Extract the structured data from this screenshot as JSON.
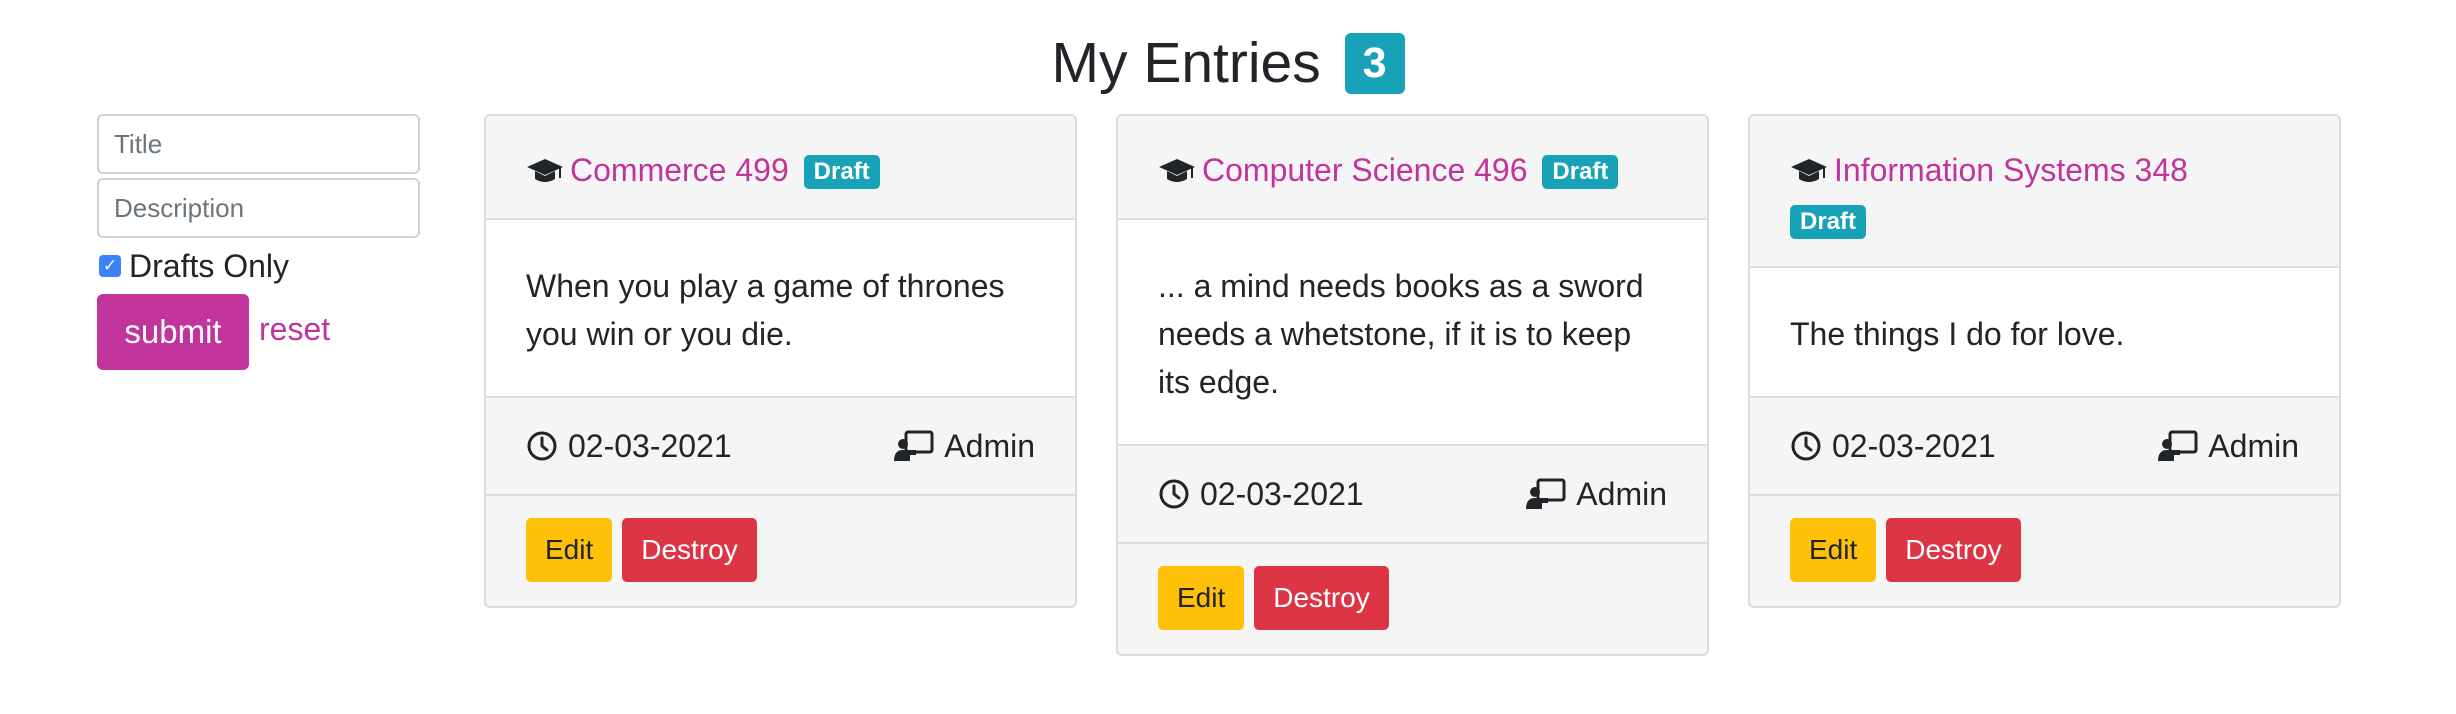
{
  "header": {
    "title": "My Entries",
    "count": "3"
  },
  "filter": {
    "title_placeholder": "Title",
    "description_placeholder": "Description",
    "drafts_label": "Drafts Only",
    "drafts_checked": true,
    "submit_label": "submit",
    "reset_label": "reset"
  },
  "entries": [
    {
      "title": "Commerce 499",
      "badge": "Draft",
      "body": "When you play a game of thrones you win or you die.",
      "date": "02-03-2021",
      "author": "Admin",
      "edit_label": "Edit",
      "destroy_label": "Destroy"
    },
    {
      "title": "Computer Science 496",
      "badge": "Draft",
      "body": "... a mind needs books as a sword needs a whetstone, if it is to keep its edge.",
      "date": "02-03-2021",
      "author": "Admin",
      "edit_label": "Edit",
      "destroy_label": "Destroy"
    },
    {
      "title": "Information Systems 348",
      "badge": "Draft",
      "body": "The things I do for love.",
      "date": "02-03-2021",
      "author": "Admin",
      "edit_label": "Edit",
      "destroy_label": "Destroy"
    }
  ],
  "icons": {
    "category": "graduation-cap-icon",
    "date": "clock-icon",
    "author": "chalkboard-teacher-icon",
    "checkbox": "checkmark-icon"
  },
  "colors": {
    "accent": "#c0349c",
    "badge": "#17a2b8",
    "edit": "#ffc107",
    "destroy": "#dc3545"
  }
}
